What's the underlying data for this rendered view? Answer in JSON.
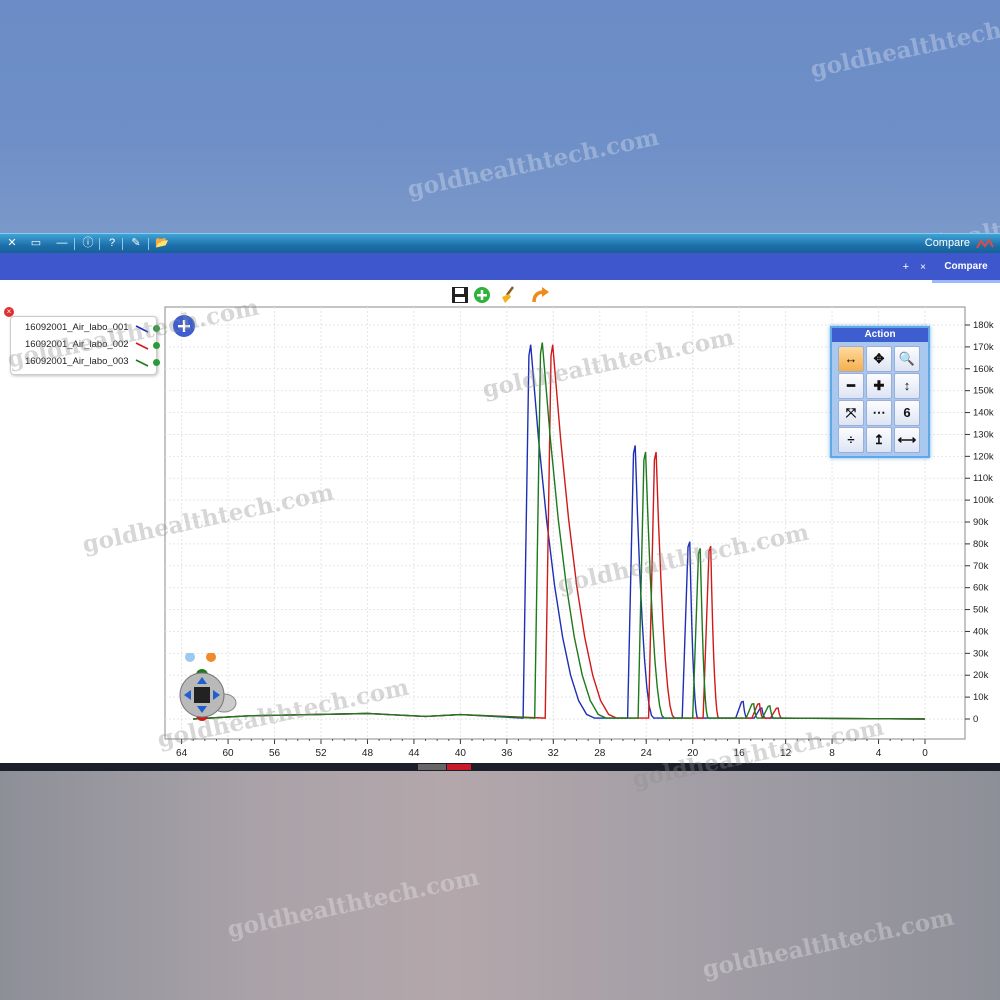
{
  "window": {
    "title": "Compare",
    "controls": [
      "✕",
      "▭",
      "—",
      "ⓘ",
      "?",
      "✎",
      "📂"
    ]
  },
  "tabs": {
    "active_label": "Compare",
    "close_label": "×",
    "add_label": "+"
  },
  "toolbar": {
    "icons": [
      "save-icon",
      "add-circle-icon",
      "broom-icon",
      "redo-arrow-icon"
    ]
  },
  "legend": {
    "items": [
      {
        "label": "16092001_Air_labo_001",
        "color": "#1f2fb5"
      },
      {
        "label": "16092001_Air_labo_002",
        "color": "#d11919"
      },
      {
        "label": "16092001_Air_labo_003",
        "color": "#1c7a1c"
      }
    ]
  },
  "action_panel": {
    "title": "Action",
    "buttons": [
      "↔",
      "✥",
      "🔍",
      "━",
      "✚",
      "↕",
      "⤧",
      "⋯",
      "6",
      "÷",
      "↥",
      "⟷"
    ]
  },
  "watermark": "goldhealthtech.com",
  "chart_data": {
    "type": "line",
    "x_axis": {
      "ticks": [
        64,
        60,
        56,
        52,
        48,
        44,
        40,
        36,
        32,
        28,
        24,
        20,
        16,
        12,
        8,
        4,
        0
      ],
      "reversed": true,
      "xlim": [
        65,
        0
      ]
    },
    "y_axis": {
      "ticks": [
        "0",
        "10k",
        "20k",
        "30k",
        "40k",
        "50k",
        "60k",
        "70k",
        "80k",
        "90k",
        "100k",
        "110k",
        "120k",
        "130k",
        "140k",
        "150k",
        "160k",
        "170k",
        "180k"
      ],
      "ylim": [
        0,
        180000
      ],
      "position": "right"
    },
    "grid": true,
    "series": [
      {
        "name": "16092001_Air_labo_001",
        "color": "#1f2fb5",
        "peaks": [
          {
            "x": 34.1,
            "y": 171000
          },
          {
            "x": 25.1,
            "y": 125000
          },
          {
            "x": 20.4,
            "y": 81000
          },
          {
            "x": 15.8,
            "y": 8000
          },
          {
            "x": 14.2,
            "y": 5000
          }
        ]
      },
      {
        "name": "16092001_Air_labo_002",
        "color": "#d11919",
        "peaks": [
          {
            "x": 32.2,
            "y": 171000
          },
          {
            "x": 23.3,
            "y": 122000
          },
          {
            "x": 18.6,
            "y": 79000
          },
          {
            "x": 14.4,
            "y": 7000
          },
          {
            "x": 12.8,
            "y": 5000
          }
        ]
      },
      {
        "name": "16092001_Air_labo_003",
        "color": "#1c7a1c",
        "peaks": [
          {
            "x": 33.1,
            "y": 172000
          },
          {
            "x": 24.2,
            "y": 122000
          },
          {
            "x": 19.5,
            "y": 78000
          },
          {
            "x": 14.9,
            "y": 7000
          },
          {
            "x": 13.5,
            "y": 6000
          }
        ]
      }
    ]
  }
}
